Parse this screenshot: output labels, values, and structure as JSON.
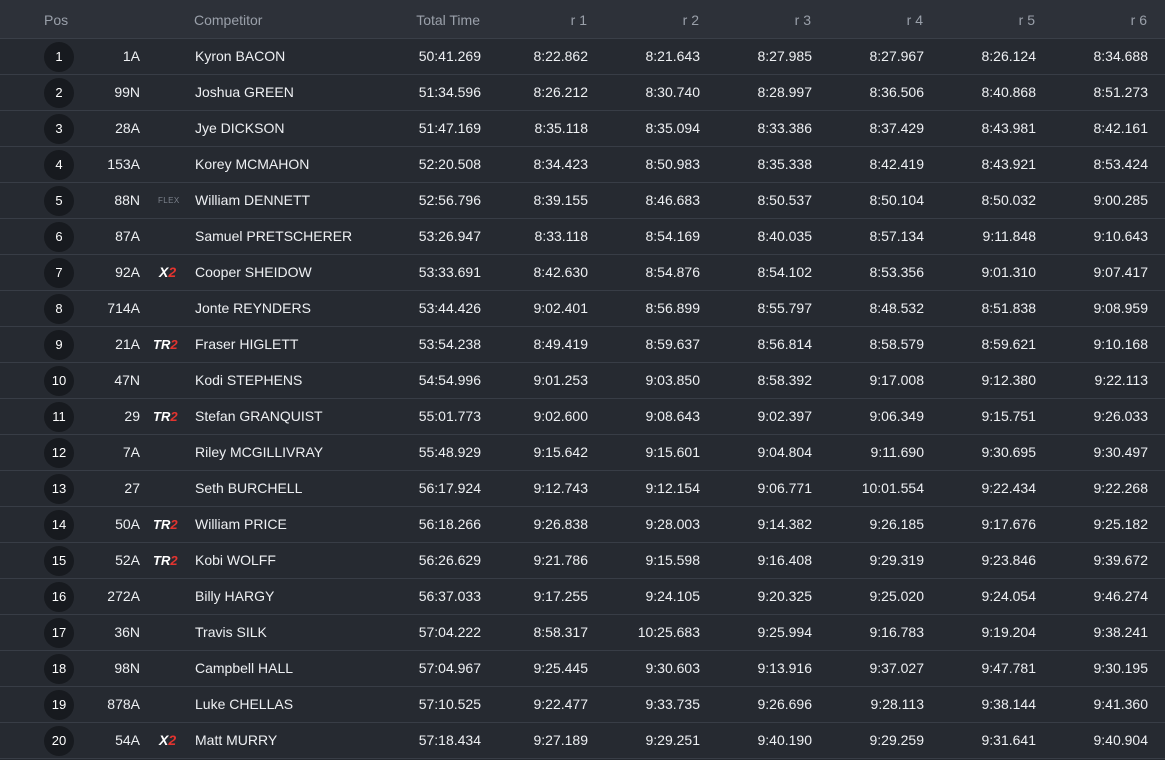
{
  "table": {
    "headers": {
      "pos": "Pos",
      "competitor": "Competitor",
      "total": "Total Time",
      "r1": "r 1",
      "r2": "r 2",
      "r3": "r 3",
      "r4": "r 4",
      "r5": "r 5",
      "r6": "r 6"
    },
    "colors": {
      "background": "#24282f",
      "header_bg": "#2d3139",
      "position_badge": "#171a1f",
      "brand_accent_red": "#e3342f"
    },
    "rows": [
      {
        "pos": "1",
        "number": "1A",
        "badge": "",
        "competitor": "Kyron BACON",
        "total": "50:41.269",
        "r1": "8:22.862",
        "r2": "8:21.643",
        "r3": "8:27.985",
        "r4": "8:27.967",
        "r5": "8:26.124",
        "r6": "8:34.688"
      },
      {
        "pos": "2",
        "number": "99N",
        "badge": "",
        "competitor": "Joshua GREEN",
        "total": "51:34.596",
        "r1": "8:26.212",
        "r2": "8:30.740",
        "r3": "8:28.997",
        "r4": "8:36.506",
        "r5": "8:40.868",
        "r6": "8:51.273"
      },
      {
        "pos": "3",
        "number": "28A",
        "badge": "",
        "competitor": "Jye DICKSON",
        "total": "51:47.169",
        "r1": "8:35.118",
        "r2": "8:35.094",
        "r3": "8:33.386",
        "r4": "8:37.429",
        "r5": "8:43.981",
        "r6": "8:42.161"
      },
      {
        "pos": "4",
        "number": "153A",
        "badge": "",
        "competitor": "Korey MCMAHON",
        "total": "52:20.508",
        "r1": "8:34.423",
        "r2": "8:50.983",
        "r3": "8:35.338",
        "r4": "8:42.419",
        "r5": "8:43.921",
        "r6": "8:53.424"
      },
      {
        "pos": "5",
        "number": "88N",
        "badge": "FLEX",
        "competitor": "William DENNETT",
        "total": "52:56.796",
        "r1": "8:39.155",
        "r2": "8:46.683",
        "r3": "8:50.537",
        "r4": "8:50.104",
        "r5": "8:50.032",
        "r6": "9:00.285"
      },
      {
        "pos": "6",
        "number": "87A",
        "badge": "",
        "competitor": "Samuel PRETSCHERER",
        "total": "53:26.947",
        "r1": "8:33.118",
        "r2": "8:54.169",
        "r3": "8:40.035",
        "r4": "8:57.134",
        "r5": "9:11.848",
        "r6": "9:10.643"
      },
      {
        "pos": "7",
        "number": "92A",
        "badge": "X2",
        "competitor": "Cooper SHEIDOW",
        "total": "53:33.691",
        "r1": "8:42.630",
        "r2": "8:54.876",
        "r3": "8:54.102",
        "r4": "8:53.356",
        "r5": "9:01.310",
        "r6": "9:07.417"
      },
      {
        "pos": "8",
        "number": "714A",
        "badge": "",
        "competitor": "Jonte REYNDERS",
        "total": "53:44.426",
        "r1": "9:02.401",
        "r2": "8:56.899",
        "r3": "8:55.797",
        "r4": "8:48.532",
        "r5": "8:51.838",
        "r6": "9:08.959"
      },
      {
        "pos": "9",
        "number": "21A",
        "badge": "TR2",
        "competitor": "Fraser HIGLETT",
        "total": "53:54.238",
        "r1": "8:49.419",
        "r2": "8:59.637",
        "r3": "8:56.814",
        "r4": "8:58.579",
        "r5": "8:59.621",
        "r6": "9:10.168"
      },
      {
        "pos": "10",
        "number": "47N",
        "badge": "",
        "competitor": "Kodi STEPHENS",
        "total": "54:54.996",
        "r1": "9:01.253",
        "r2": "9:03.850",
        "r3": "8:58.392",
        "r4": "9:17.008",
        "r5": "9:12.380",
        "r6": "9:22.113"
      },
      {
        "pos": "11",
        "number": "29",
        "badge": "TR2",
        "competitor": "Stefan GRANQUIST",
        "total": "55:01.773",
        "r1": "9:02.600",
        "r2": "9:08.643",
        "r3": "9:02.397",
        "r4": "9:06.349",
        "r5": "9:15.751",
        "r6": "9:26.033"
      },
      {
        "pos": "12",
        "number": "7A",
        "badge": "",
        "competitor": "Riley MCGILLIVRAY",
        "total": "55:48.929",
        "r1": "9:15.642",
        "r2": "9:15.601",
        "r3": "9:04.804",
        "r4": "9:11.690",
        "r5": "9:30.695",
        "r6": "9:30.497"
      },
      {
        "pos": "13",
        "number": "27",
        "badge": "",
        "competitor": "Seth BURCHELL",
        "total": "56:17.924",
        "r1": "9:12.743",
        "r2": "9:12.154",
        "r3": "9:06.771",
        "r4": "10:01.554",
        "r5": "9:22.434",
        "r6": "9:22.268"
      },
      {
        "pos": "14",
        "number": "50A",
        "badge": "TR2",
        "competitor": "William PRICE",
        "total": "56:18.266",
        "r1": "9:26.838",
        "r2": "9:28.003",
        "r3": "9:14.382",
        "r4": "9:26.185",
        "r5": "9:17.676",
        "r6": "9:25.182"
      },
      {
        "pos": "15",
        "number": "52A",
        "badge": "TR2",
        "competitor": "Kobi WOLFF",
        "total": "56:26.629",
        "r1": "9:21.786",
        "r2": "9:15.598",
        "r3": "9:16.408",
        "r4": "9:29.319",
        "r5": "9:23.846",
        "r6": "9:39.672"
      },
      {
        "pos": "16",
        "number": "272A",
        "badge": "",
        "competitor": "Billy HARGY",
        "total": "56:37.033",
        "r1": "9:17.255",
        "r2": "9:24.105",
        "r3": "9:20.325",
        "r4": "9:25.020",
        "r5": "9:24.054",
        "r6": "9:46.274"
      },
      {
        "pos": "17",
        "number": "36N",
        "badge": "",
        "competitor": "Travis SILK",
        "total": "57:04.222",
        "r1": "8:58.317",
        "r2": "10:25.683",
        "r3": "9:25.994",
        "r4": "9:16.783",
        "r5": "9:19.204",
        "r6": "9:38.241"
      },
      {
        "pos": "18",
        "number": "98N",
        "badge": "",
        "competitor": "Campbell HALL",
        "total": "57:04.967",
        "r1": "9:25.445",
        "r2": "9:30.603",
        "r3": "9:13.916",
        "r4": "9:37.027",
        "r5": "9:47.781",
        "r6": "9:30.195"
      },
      {
        "pos": "19",
        "number": "878A",
        "badge": "",
        "competitor": "Luke CHELLAS",
        "total": "57:10.525",
        "r1": "9:22.477",
        "r2": "9:33.735",
        "r3": "9:26.696",
        "r4": "9:28.113",
        "r5": "9:38.144",
        "r6": "9:41.360"
      },
      {
        "pos": "20",
        "number": "54A",
        "badge": "X2",
        "competitor": "Matt MURRY",
        "total": "57:18.434",
        "r1": "9:27.189",
        "r2": "9:29.251",
        "r3": "9:40.190",
        "r4": "9:29.259",
        "r5": "9:31.641",
        "r6": "9:40.904"
      }
    ]
  }
}
